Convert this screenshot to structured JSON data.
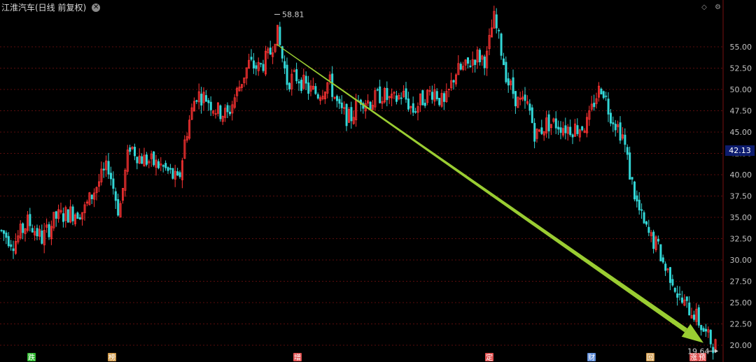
{
  "title": {
    "name": "江淮汽车(日线 前复权)"
  },
  "icons": {
    "close": "close-icon",
    "diamond": "diamond-icon",
    "settings": "gear-icon"
  },
  "current_price": "42.13",
  "high_marker": "58.81",
  "low_marker": "19.64",
  "colors": {
    "up": "#ff3333",
    "down": "#33d6d6",
    "grid": "#5a0d0d",
    "trend": "#9acd32",
    "axis_text": "#c0c0c0"
  },
  "chart_data": {
    "type": "candlestick",
    "title": "江淮汽车(日线 前复权)",
    "y_ticks": [
      20.0,
      22.5,
      25.0,
      27.5,
      30.0,
      32.5,
      35.0,
      37.5,
      40.0,
      42.5,
      45.0,
      47.5,
      50.0,
      52.5,
      55.0
    ],
    "ylim": [
      19.2,
      60.0
    ],
    "grid": true,
    "approx_close_path": [
      [
        0,
        33.5
      ],
      [
        20,
        32.0
      ],
      [
        40,
        34.5
      ],
      [
        60,
        32.5
      ],
      [
        80,
        35.0
      ],
      [
        100,
        35.5
      ],
      [
        120,
        35.8
      ],
      [
        140,
        39.0
      ],
      [
        155,
        41.0
      ],
      [
        170,
        35.5
      ],
      [
        185,
        43.5
      ],
      [
        200,
        42.0
      ],
      [
        215,
        41.5
      ],
      [
        230,
        41.0
      ],
      [
        245,
        40.0
      ],
      [
        255,
        39.0
      ],
      [
        265,
        44.5
      ],
      [
        280,
        49.5
      ],
      [
        295,
        49.0
      ],
      [
        310,
        47.5
      ],
      [
        325,
        47.0
      ],
      [
        340,
        50.0
      ],
      [
        355,
        53.0
      ],
      [
        370,
        52.5
      ],
      [
        385,
        54.0
      ],
      [
        395,
        57.0
      ],
      [
        410,
        51.0
      ],
      [
        425,
        51.5
      ],
      [
        440,
        50.0
      ],
      [
        455,
        49.5
      ],
      [
        470,
        51.0
      ],
      [
        485,
        47.5
      ],
      [
        500,
        46.5
      ],
      [
        515,
        49.0
      ],
      [
        530,
        48.5
      ],
      [
        545,
        49.5
      ],
      [
        560,
        48.5
      ],
      [
        575,
        49.5
      ],
      [
        590,
        47.5
      ],
      [
        605,
        49.0
      ],
      [
        620,
        50.0
      ],
      [
        635,
        48.0
      ],
      [
        650,
        52.0
      ],
      [
        665,
        52.5
      ],
      [
        680,
        54.0
      ],
      [
        695,
        53.5
      ],
      [
        705,
        58.5
      ],
      [
        715,
        55.0
      ],
      [
        725,
        51.0
      ],
      [
        740,
        48.5
      ],
      [
        755,
        48.0
      ],
      [
        765,
        44.5
      ],
      [
        780,
        46.0
      ],
      [
        795,
        46.0
      ],
      [
        810,
        45.5
      ],
      [
        825,
        45.5
      ],
      [
        840,
        46.0
      ],
      [
        850,
        49.0
      ],
      [
        860,
        50.5
      ],
      [
        870,
        47.5
      ],
      [
        880,
        46.0
      ],
      [
        890,
        44.5
      ],
      [
        900,
        40.0
      ],
      [
        910,
        36.5
      ],
      [
        920,
        34.0
      ],
      [
        930,
        32.5
      ],
      [
        940,
        31.5
      ],
      [
        950,
        29.0
      ],
      [
        960,
        28.0
      ],
      [
        970,
        25.5
      ],
      [
        980,
        24.5
      ],
      [
        990,
        24.0
      ],
      [
        1000,
        22.5
      ],
      [
        1010,
        21.0
      ],
      [
        1020,
        20.0
      ]
    ],
    "trend_line": {
      "from": [
        395,
        55.3
      ],
      "to": [
        1000,
        20.6
      ]
    },
    "event_markers": [
      {
        "label": "跌",
        "x": 45,
        "color": "#2eb82e"
      },
      {
        "label": "榜",
        "x": 160,
        "color": "#d09a4a"
      },
      {
        "label": "增",
        "x": 425,
        "color": "#e05050"
      },
      {
        "label": "定",
        "x": 699,
        "color": "#e05050"
      },
      {
        "label": "财",
        "x": 845,
        "color": "#5a8ad8"
      },
      {
        "label": "回",
        "x": 929,
        "color": "#d09a4a"
      },
      {
        "label": "涨",
        "x": 991,
        "color": "#e05050"
      },
      {
        "label": "预",
        "x": 1003,
        "color": "#e05050"
      }
    ]
  }
}
